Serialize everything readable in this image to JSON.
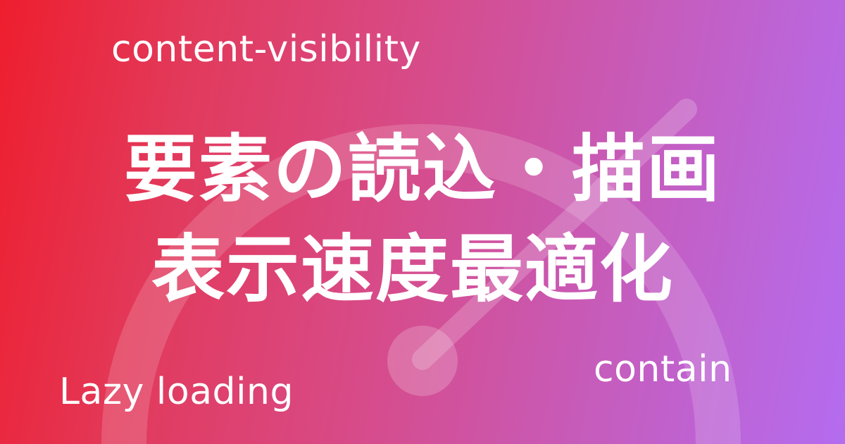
{
  "keywords": {
    "top": "content-visibility",
    "bottom_left": "Lazy loading",
    "bottom_right": "contain"
  },
  "title": {
    "line1": "要素の読込・描画",
    "line2": "表示速度最適化"
  },
  "colors": {
    "gradient_start": "#ee1e2e",
    "gradient_end": "#b46cf0",
    "text": "#ffffff"
  },
  "decoration": {
    "gauge_icon": "speedometer-icon"
  }
}
